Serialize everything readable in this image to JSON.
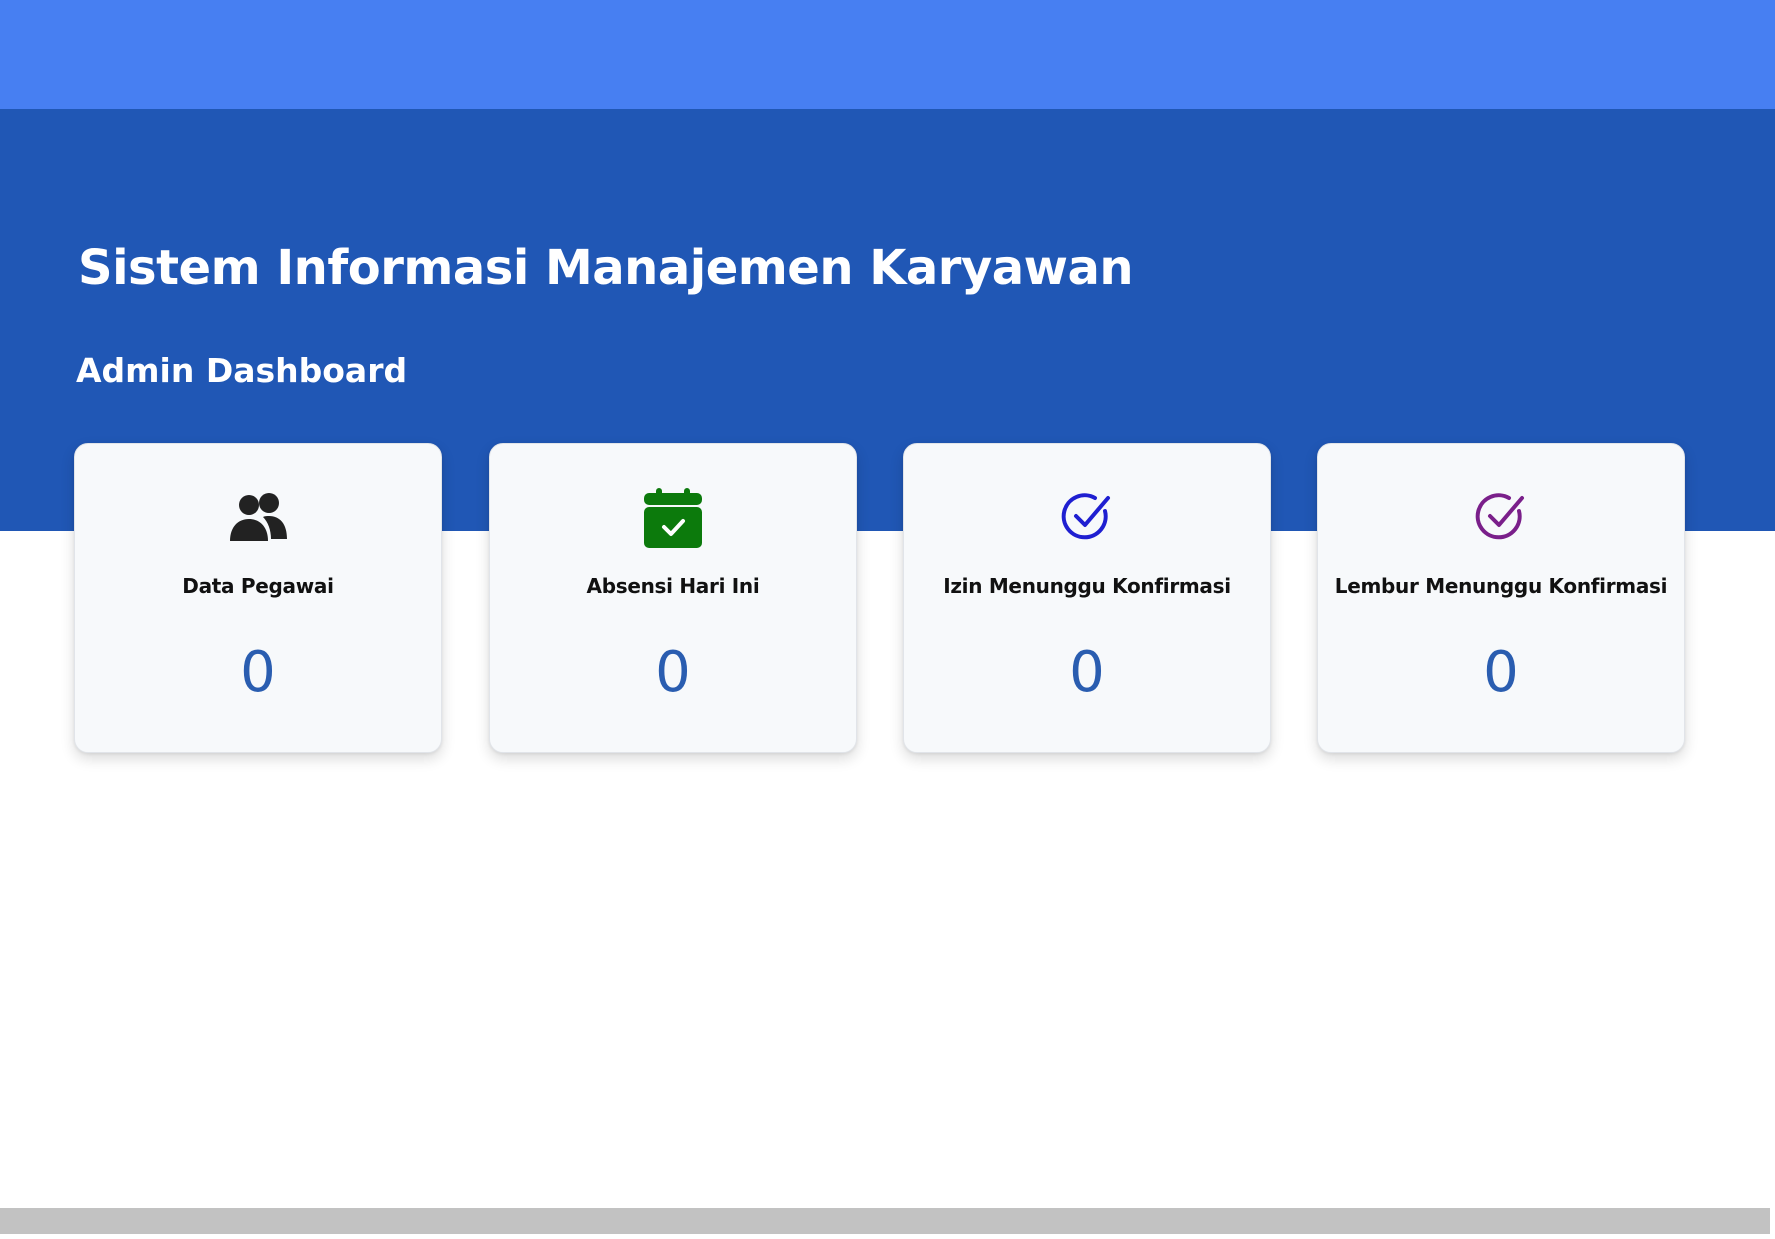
{
  "header": {
    "app_title": "Sistem Informasi Manajemen Karyawan",
    "page_subtitle": "Admin Dashboard"
  },
  "colors": {
    "topbar": "#477ff2",
    "hero": "#2057b5",
    "value_text": "#2a5db0",
    "icon_employees": "#222222",
    "icon_attendance": "#0c7a0c",
    "icon_leave": "#1f1fd1",
    "icon_overtime": "#7a1f8a"
  },
  "cards": [
    {
      "label": "Data Pegawai",
      "value": "0",
      "icon": "users-icon"
    },
    {
      "label": "Absensi Hari Ini",
      "value": "0",
      "icon": "calendar-check-icon"
    },
    {
      "label": "Izin Menunggu Konfirmasi",
      "value": "0",
      "icon": "check-circle-icon"
    },
    {
      "label": "Lembur Menunggu Konfirmasi",
      "value": "0",
      "icon": "check-circle-icon"
    }
  ]
}
